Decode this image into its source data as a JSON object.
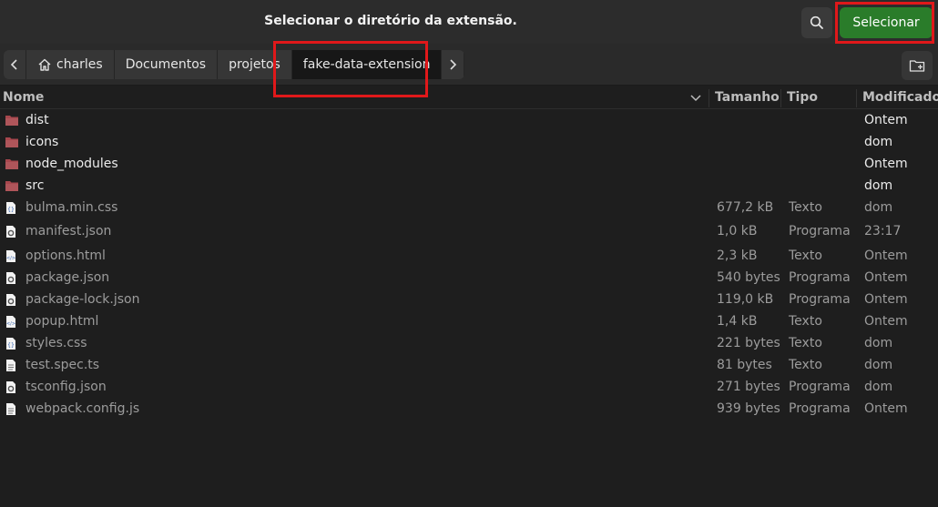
{
  "dialog": {
    "title": "Selecionar o diretório da extensão.",
    "select_label": "Selecionar",
    "accent_color": "#2a7c2a",
    "highlight_color": "#e0181a"
  },
  "breadcrumb": {
    "items": [
      "charles",
      "Documentos",
      "projetos",
      "fake-data-extension"
    ],
    "active": "fake-data-extension"
  },
  "columns": {
    "name": "Nome",
    "size": "Tamanho",
    "type": "Tipo",
    "modified": "Modificado"
  },
  "files": [
    {
      "name": "dist",
      "size": "",
      "type": "",
      "modified": "Ontem",
      "icon": "folder-icon"
    },
    {
      "name": "icons",
      "size": "",
      "type": "",
      "modified": "dom",
      "icon": "folder-icon"
    },
    {
      "name": "node_modules",
      "size": "",
      "type": "",
      "modified": "Ontem",
      "icon": "folder-icon"
    },
    {
      "name": "src",
      "size": "",
      "type": "",
      "modified": "dom",
      "icon": "folder-icon"
    },
    {
      "name": "bulma.min.css",
      "size": "677,2 kB",
      "type": "Texto",
      "modified": "dom",
      "icon": "css-file-icon"
    },
    {
      "name": "manifest.json",
      "size": "1,0 kB",
      "type": "Programa",
      "modified": "23:17",
      "icon": "json-file-icon"
    },
    {
      "name": "options.html",
      "size": "2,3 kB",
      "type": "Texto",
      "modified": "Ontem",
      "icon": "html-file-icon"
    },
    {
      "name": "package.json",
      "size": "540 bytes",
      "type": "Programa",
      "modified": "Ontem",
      "icon": "json-file-icon"
    },
    {
      "name": "package-lock.json",
      "size": "119,0 kB",
      "type": "Programa",
      "modified": "Ontem",
      "icon": "json-file-icon"
    },
    {
      "name": "popup.html",
      "size": "1,4 kB",
      "type": "Texto",
      "modified": "Ontem",
      "icon": "html-file-icon"
    },
    {
      "name": "styles.css",
      "size": "221 bytes",
      "type": "Texto",
      "modified": "dom",
      "icon": "css-file-icon"
    },
    {
      "name": "test.spec.ts",
      "size": "81 bytes",
      "type": "Texto",
      "modified": "dom",
      "icon": "text-file-icon"
    },
    {
      "name": "tsconfig.json",
      "size": "271 bytes",
      "type": "Programa",
      "modified": "dom",
      "icon": "json-file-icon"
    },
    {
      "name": "webpack.config.js",
      "size": "939 bytes",
      "type": "Programa",
      "modified": "Ontem",
      "icon": "text-file-icon"
    }
  ]
}
